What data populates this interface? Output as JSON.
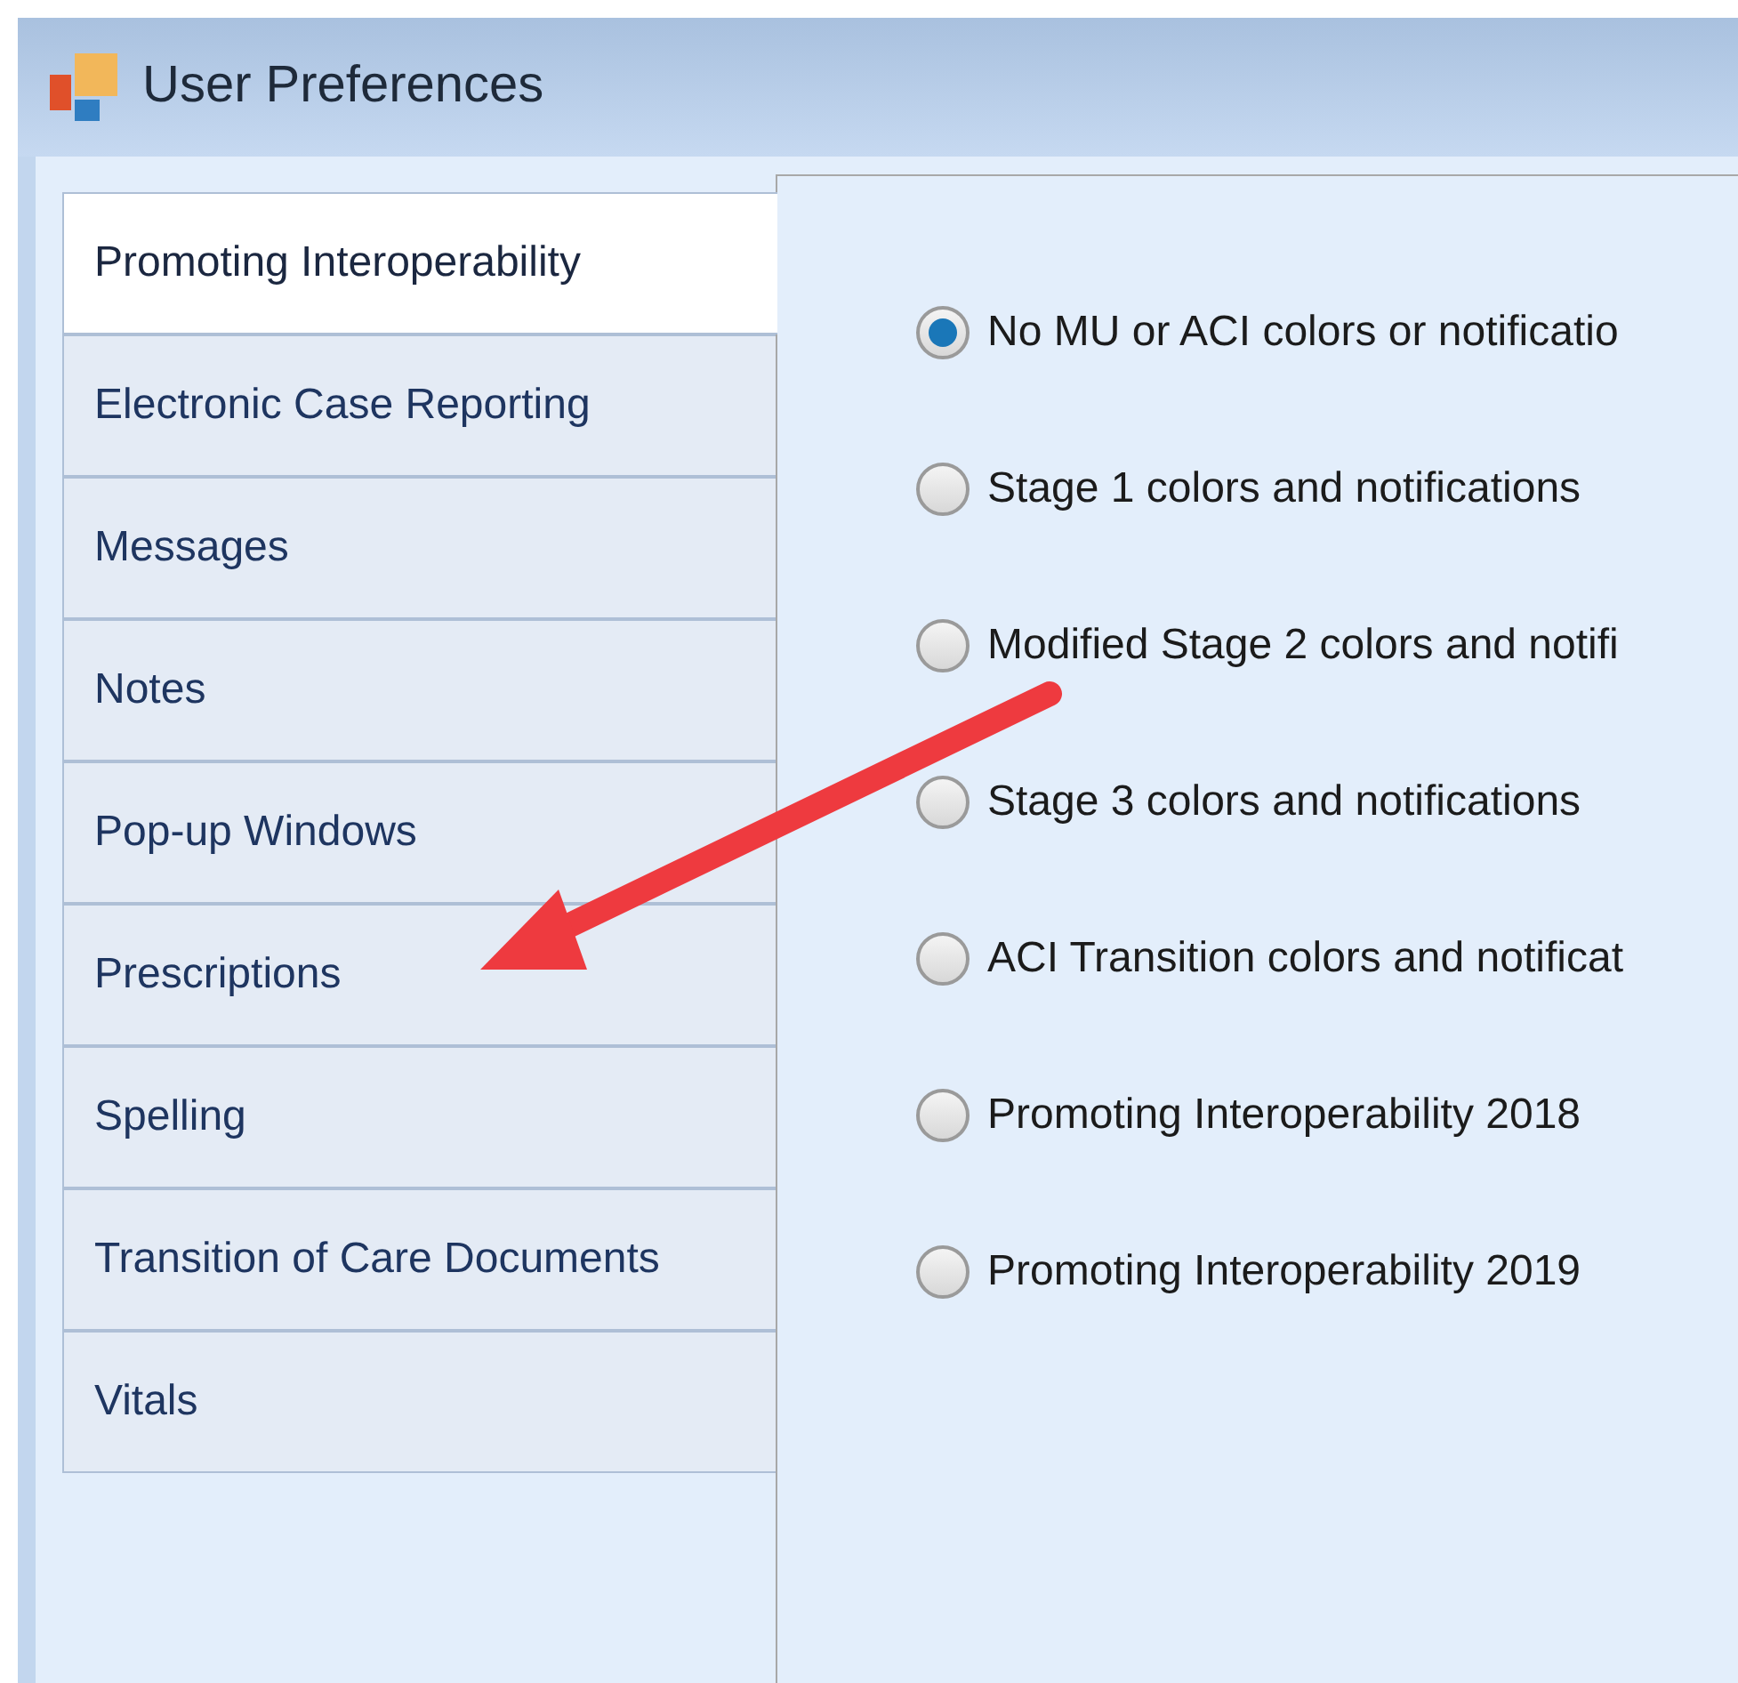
{
  "window": {
    "title": "User Preferences"
  },
  "tabs": [
    {
      "label": "Promoting Interoperability",
      "selected": true
    },
    {
      "label": "Electronic Case Reporting",
      "selected": false
    },
    {
      "label": "Messages",
      "selected": false
    },
    {
      "label": "Notes",
      "selected": false
    },
    {
      "label": "Pop-up Windows",
      "selected": false
    },
    {
      "label": "Prescriptions",
      "selected": false
    },
    {
      "label": "Spelling",
      "selected": false
    },
    {
      "label": "Transition of Care Documents",
      "selected": false
    },
    {
      "label": "Vitals",
      "selected": false
    }
  ],
  "options": [
    {
      "label": "No MU or ACI colors or notificatio",
      "selected": true
    },
    {
      "label": "Stage 1 colors and notifications",
      "selected": false
    },
    {
      "label": "Modified Stage 2 colors and notifi",
      "selected": false
    },
    {
      "label": "Stage 3 colors and notifications",
      "selected": false
    },
    {
      "label": "ACI Transition colors and notificat",
      "selected": false
    },
    {
      "label": "Promoting Interoperability 2018",
      "selected": false
    },
    {
      "label": "Promoting Interoperability 2019",
      "selected": false
    }
  ]
}
